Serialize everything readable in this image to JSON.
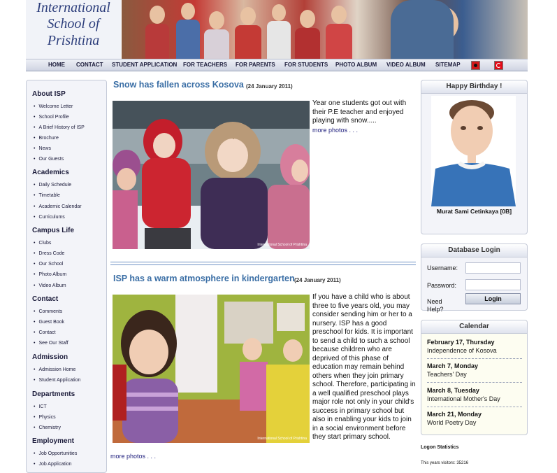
{
  "logo": {
    "line1": "International",
    "line2": "School of",
    "line3": "Prishtina"
  },
  "nav": {
    "items": [
      "HOME",
      "CONTACT",
      "STUDENT APPLICATION",
      "FOR TEACHERS",
      "FOR PARENTS",
      "FOR STUDENTS",
      "PHOTO ALBUM",
      "VIDEO ALBUM",
      "SITEMAP"
    ],
    "flags": [
      "albania-flag-icon",
      "turkey-flag-icon"
    ]
  },
  "sidebar": {
    "sections": [
      {
        "title": "About ISP",
        "items": [
          "Welcome Letter",
          "School Profile",
          "A Brief History of ISP",
          "Brochure",
          "News",
          "Our Guests"
        ]
      },
      {
        "title": "Academics",
        "items": [
          "Daily Schedule",
          "Timetable",
          "Academic Calendar",
          "Curriculums"
        ]
      },
      {
        "title": "Campus Life",
        "items": [
          "Clubs",
          "Dress Code",
          "Our School",
          "Photo Album",
          "Video Album"
        ]
      },
      {
        "title": "Contact",
        "items": [
          "Comments",
          "Guest Book",
          "Contact",
          "See Our Staff"
        ]
      },
      {
        "title": "Admission",
        "items": [
          "Admission Home",
          "Student Application"
        ]
      },
      {
        "title": "Departments",
        "items": [
          "ICT",
          "Physics",
          "Chemistry"
        ]
      },
      {
        "title": "Employment",
        "items": [
          "Job Opportunities",
          "Job Application"
        ]
      }
    ]
  },
  "articles": [
    {
      "title": "Snow has fallen across Kosova",
      "date": "(24 January 2011)",
      "text": "Year one students got out with their P.E teacher and enjoyed playing with snow.....",
      "more": "more photos . . .",
      "watermark": "International School of Prishtina"
    },
    {
      "title": "ISP has a warm atmosphere in kindergarten",
      "date": "(24 January 2011)",
      "text": "If you have a child who is about three to five years old, you may consider sending him or her to a nursery. ISP has a good preschool for kids. It is important to send a child to such a school because children who are deprived of this phase of education may remain behind others when they join primary school. Therefore, participating in a well qualified preschool plays major role not only in your child's success in primary school but also in enabling your kids to join in a social environment before they start primary school.",
      "more": "more photos . . .",
      "watermark": "International School of Prishtina"
    }
  ],
  "birthday": {
    "title": "Happy Birthday !",
    "name": "Murat Sami Cetinkaya [0B]"
  },
  "login": {
    "title": "Database Login",
    "username_label": "Username:",
    "password_label": "Password:",
    "help": "Need Help?",
    "button": "Login",
    "username_value": "",
    "password_value": ""
  },
  "calendar": {
    "title": "Calendar",
    "entries": [
      {
        "date": "February 17, Thursday",
        "event": "Independence of Kosova"
      },
      {
        "date": "March 7, Monday",
        "event": "Teachers' Day"
      },
      {
        "date": "March 8, Tuesday",
        "event": "International Mother's Day"
      },
      {
        "date": "March 21, Monday",
        "event": "World Poetry Day"
      }
    ]
  },
  "stats": {
    "title": "Logon Statistics",
    "visitors": "This years visitors: 35216"
  }
}
